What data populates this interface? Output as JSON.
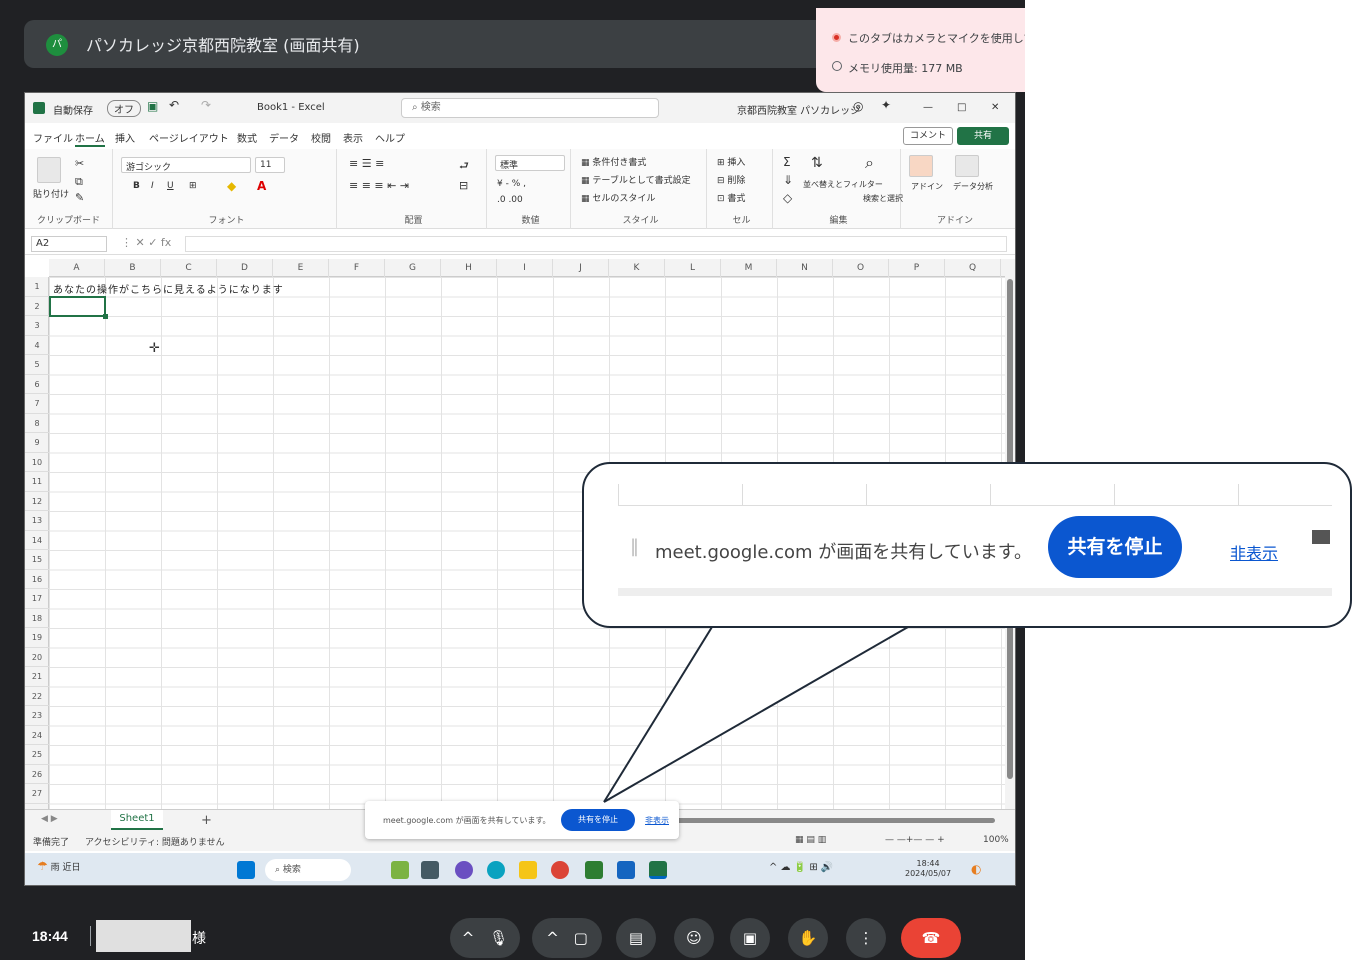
{
  "meet": {
    "presenter_initial": "パ",
    "title": "パソカレッジ京都西院教室 (画面共有)",
    "time": "18:44",
    "user_suffix": "様",
    "controls": {
      "chevron": "^",
      "mic": "🎙",
      "camera": "▢",
      "captions": "▤",
      "emoji": "☺",
      "present": "▣",
      "hand": "✋",
      "more": "⋮",
      "end": "☎"
    }
  },
  "chrome_popup": {
    "recording": "このタブはカメラとマイクを使用して",
    "memory": "メモリ使用量: 177 MB"
  },
  "excel": {
    "titlebar": {
      "autosave": "自動保存",
      "toggle": "オフ",
      "doc_title": "Book1 - Excel",
      "search": "検索",
      "account": "京都西院教室 パソカレッジ"
    },
    "menu": [
      "ファイル",
      "ホーム",
      "挿入",
      "ページレイアウト",
      "数式",
      "データ",
      "校閲",
      "表示",
      "ヘルプ"
    ],
    "comment_label": "コメント",
    "share_label": "共有",
    "ribbon_groups": [
      "クリップボード",
      "フォント",
      "配置",
      "数値",
      "スタイル",
      "セル",
      "編集",
      "アドイン"
    ],
    "ribbon_items": {
      "paste": "貼り付け",
      "font_name": "游ゴシック",
      "font_size": "11",
      "number_format": "標準",
      "cond_format": "条件付き書式",
      "table_format": "テーブルとして書式設定",
      "cell_style": "セルのスタイル",
      "insert": "挿入",
      "delete": "削除",
      "format": "書式",
      "sort": "並べ替えとフィルター",
      "find": "検索と選択",
      "addin": "アドイン",
      "analyze": "データ分析"
    },
    "name_box": "A2",
    "columns": [
      "A",
      "B",
      "C",
      "D",
      "E",
      "F",
      "G",
      "H",
      "I",
      "J",
      "K",
      "L",
      "M",
      "N",
      "O",
      "P",
      "Q"
    ],
    "rows": [
      "1",
      "2",
      "3",
      "4",
      "5",
      "6",
      "7",
      "8",
      "9",
      "10",
      "11",
      "12",
      "13",
      "14",
      "15",
      "16",
      "17",
      "18",
      "19",
      "20",
      "21",
      "22",
      "23",
      "24",
      "25",
      "26",
      "27"
    ],
    "a1_value": "あなたの操作がこちらに見えるようになります",
    "sheet_tab": "Sheet1",
    "status_ready": "準備完了",
    "status_access": "アクセシビリティ: 問題ありません",
    "zoom": "100%",
    "small_banner": {
      "text": "meet.google.com が画面を共有しています。",
      "stop": "共有を停止",
      "hide": "非表示"
    },
    "taskbar": {
      "weather": "雨",
      "weather_sub": "近日",
      "search": "検索",
      "time": "18:44",
      "date": "2024/05/07"
    }
  },
  "callout": {
    "text": "meet.google.com が画面を共有しています。",
    "stop": "共有を停止",
    "hide": "非表示"
  },
  "colors": {
    "excel_green": "#217346",
    "google_blue": "#0b57d0",
    "meet_dark": "#202124",
    "end_call_red": "#ea4335"
  }
}
